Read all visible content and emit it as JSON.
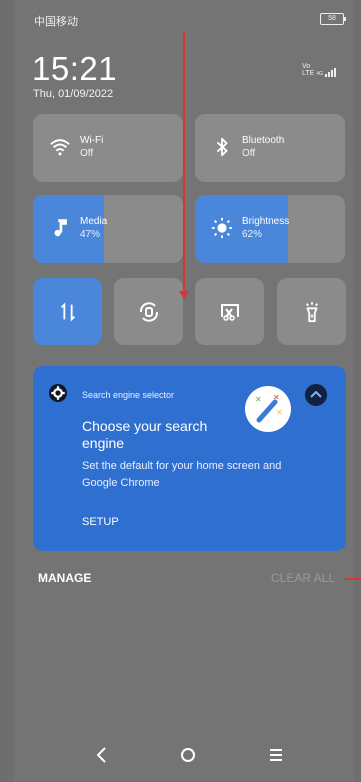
{
  "status": {
    "carrier": "中国移动",
    "battery": "58"
  },
  "clock": {
    "time": "15:21",
    "date": "Thu, 01/09/2022"
  },
  "signal": {
    "tech_top": "Vo",
    "tech_bottom": "LTE",
    "band": "4G"
  },
  "tiles": {
    "wifi": {
      "label": "Wi-Fi",
      "value": "Off"
    },
    "bluetooth": {
      "label": "Bluetooth",
      "value": "Off"
    },
    "media": {
      "label": "Media",
      "value": "47%",
      "level": 0.47
    },
    "brightness": {
      "label": "Brightness",
      "value": "62%",
      "level": 0.62
    }
  },
  "notification": {
    "app_name": "Search engine selector",
    "title": "Choose your search engine",
    "description": "Set the default for your home screen and Google Chrome",
    "action": "SETUP"
  },
  "footer": {
    "manage": "MANAGE",
    "clear_all": "CLEAR ALL"
  },
  "colors": {
    "accent": "#4a86d9",
    "card": "#2f6fd0"
  }
}
